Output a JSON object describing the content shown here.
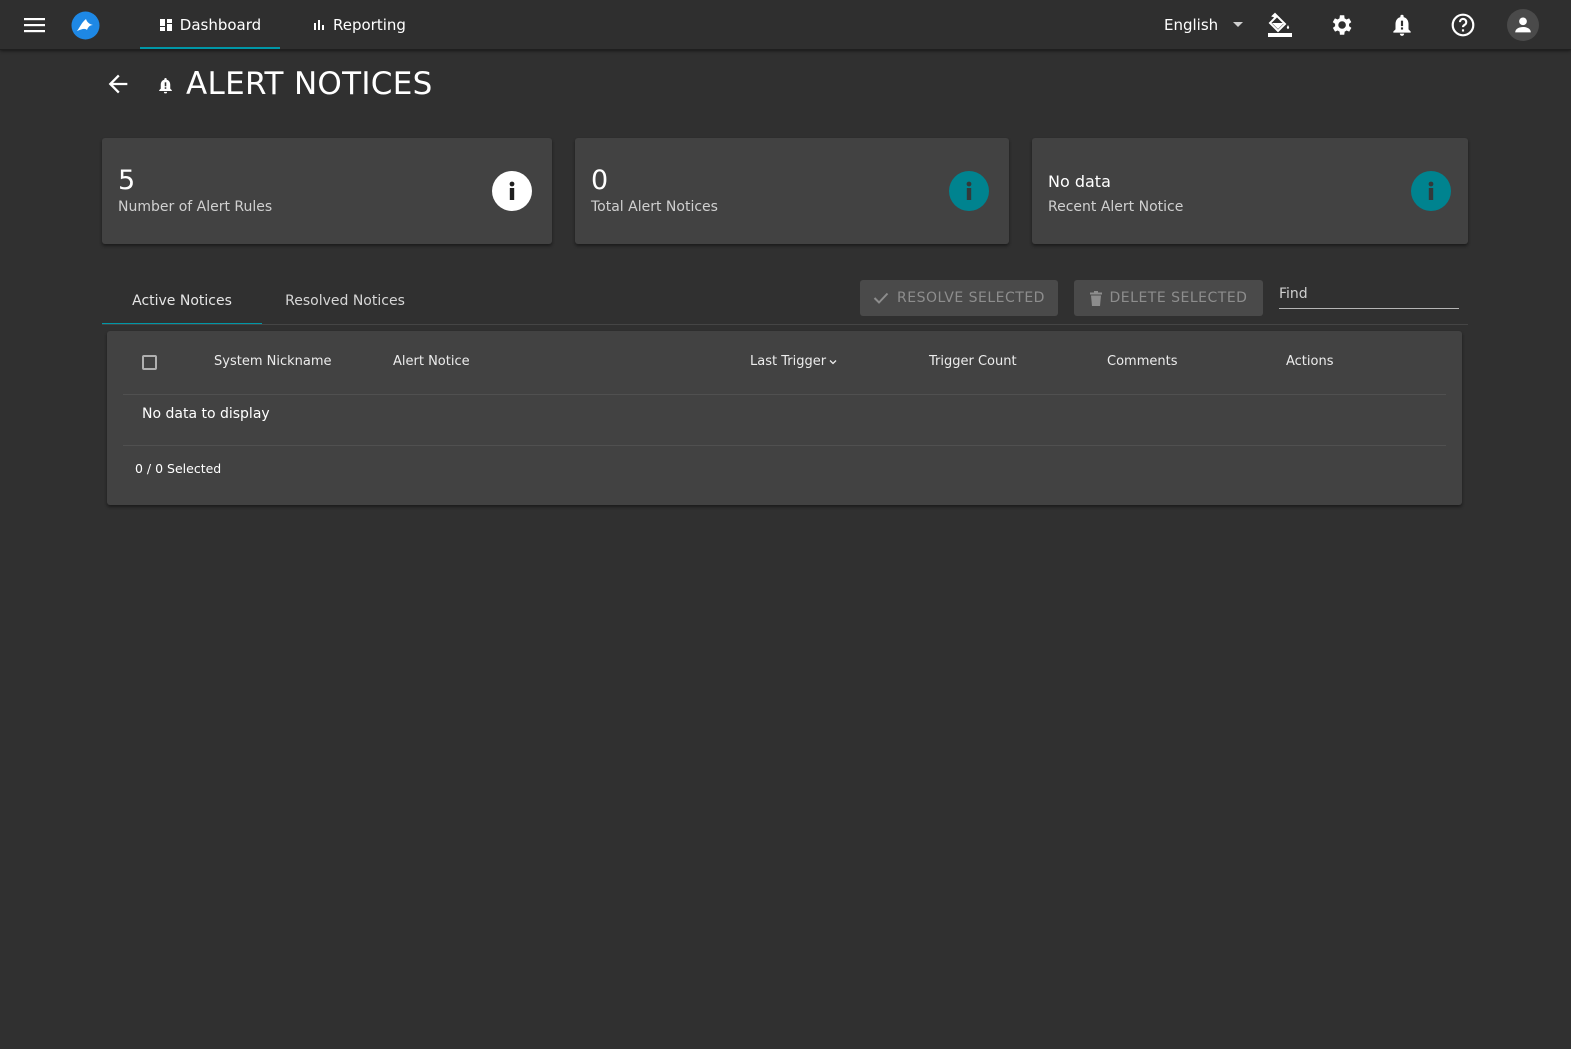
{
  "nav": {
    "dashboard_label": "Dashboard",
    "reporting_label": "Reporting",
    "language": "English",
    "accent_color": "#0097a7"
  },
  "icons": [
    "menu-icon",
    "logo-icon",
    "dashboard-icon",
    "bar-chart-icon",
    "caret-down-icon",
    "paint-bucket-icon",
    "gear-icon",
    "bell-icon",
    "help-icon",
    "person-icon",
    "arrow-back-icon",
    "info-icon",
    "check-icon",
    "trash-icon"
  ],
  "page": {
    "title": "ALERT NOTICES"
  },
  "cards": [
    {
      "value": "5",
      "label": "Number of Alert Rules"
    },
    {
      "value": "0",
      "label": "Total Alert Notices"
    },
    {
      "value": "No data",
      "label": "Recent Alert Notice"
    }
  ],
  "tabs": {
    "active": "Active Notices",
    "resolved": "Resolved Notices"
  },
  "actions": {
    "resolve": "RESOLVE SELECTED",
    "delete": "DELETE SELECTED",
    "find_placeholder": "Find"
  },
  "table": {
    "columns": [
      "System Nickname",
      "Alert Notice",
      "Last Trigger",
      "Trigger Count",
      "Comments",
      "Actions"
    ],
    "empty_message": "No data to display",
    "selected_count": "0 / 0 Selected"
  }
}
